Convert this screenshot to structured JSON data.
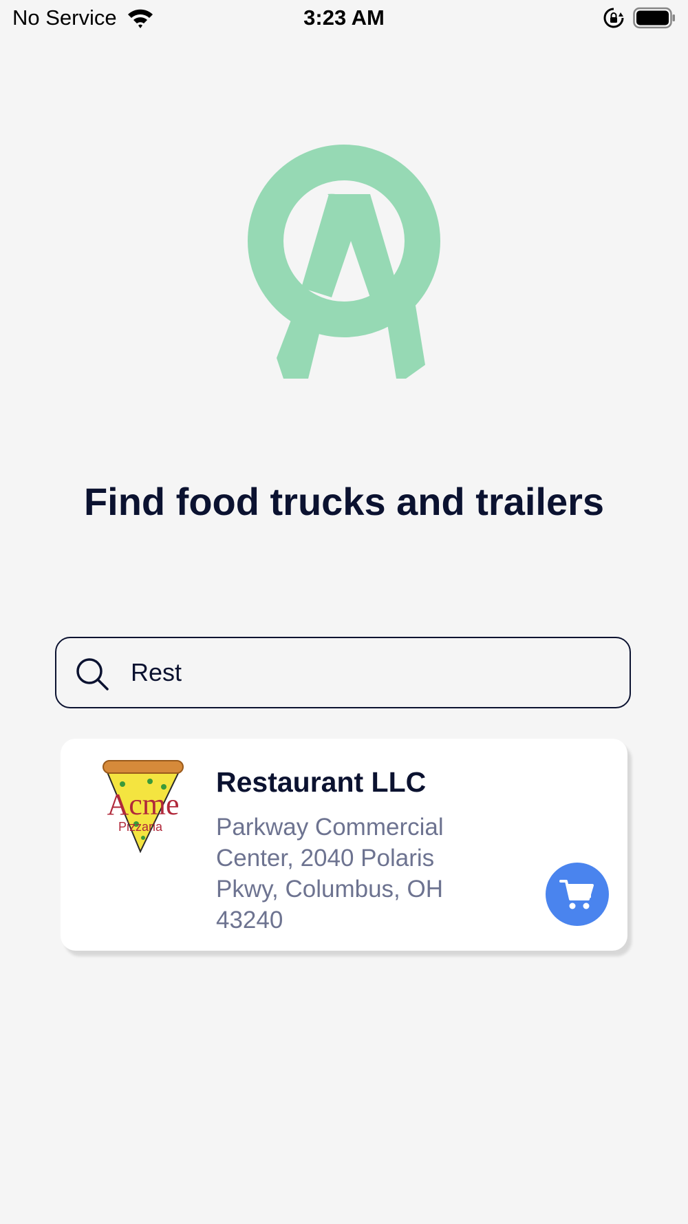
{
  "status_bar": {
    "carrier": "No Service",
    "time": "3:23 AM"
  },
  "colors": {
    "logo_green": "#96d9b4",
    "headline": "#0b1230",
    "address_gray": "#6d7390",
    "cart_blue": "#4a84ee",
    "background": "#f5f5f5"
  },
  "main": {
    "headline": "Find food trucks and trailers"
  },
  "search": {
    "value": "Rest",
    "icon": "search-icon"
  },
  "results": [
    {
      "name": "Restaurant LLC",
      "address": "Parkway Commercial Center, 2040 Polaris Pkwy, Columbus, OH 43240",
      "logo": {
        "brand": "Acme",
        "sub": "Pizzaria"
      },
      "action_icon": "cart-icon"
    }
  ]
}
